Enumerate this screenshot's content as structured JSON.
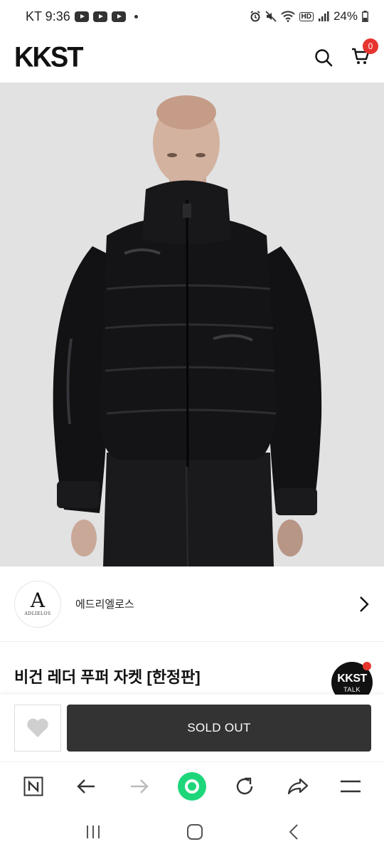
{
  "status_bar": {
    "carrier_time": "KT 9:36",
    "battery": "24%",
    "hd": "HD"
  },
  "header": {
    "logo": "KKST",
    "cart_count": "0"
  },
  "brand": {
    "logo_text": "ADLIELOS",
    "name": "에드리엘로스"
  },
  "product": {
    "title": "비건 레더 푸퍼 자켓 [한정판]"
  },
  "talk": {
    "logo": "KKST",
    "sub": "TALK"
  },
  "purchase": {
    "soldout_label": "SOLD OUT"
  },
  "colors": {
    "accent_red": "#e8342f",
    "button_dark": "#333333",
    "browser_green": "#1ed67a"
  },
  "icons": {
    "header": [
      "search-icon",
      "cart-icon"
    ],
    "browser": [
      "naver-n-icon",
      "back-arrow-icon",
      "forward-arrow-icon",
      "green-dot-icon",
      "refresh-icon",
      "share-icon",
      "menu-icon"
    ],
    "system": [
      "recent-apps-icon",
      "home-icon",
      "back-icon"
    ]
  }
}
